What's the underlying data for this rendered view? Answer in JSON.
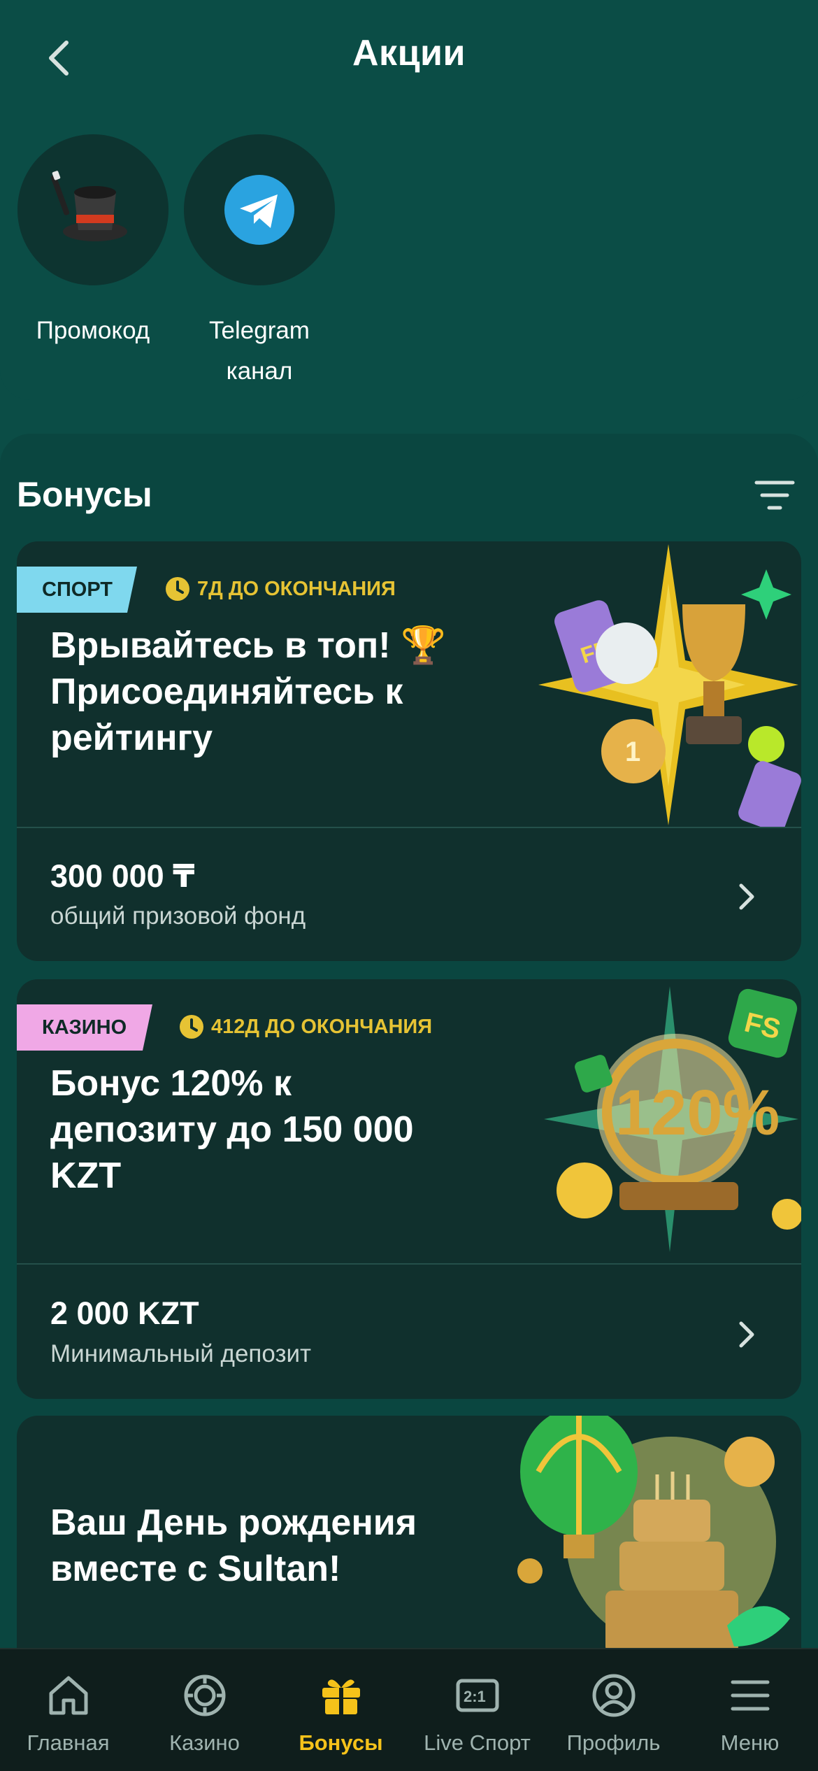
{
  "header": {
    "title": "Акции",
    "shortcuts": [
      {
        "label_line1": "Промокод",
        "label_line2": "",
        "icon": "magic-hat-icon"
      },
      {
        "label_line1": "Telegram",
        "label_line2": "канал",
        "icon": "telegram-icon"
      }
    ]
  },
  "bonuses": {
    "title": "Бонусы",
    "cards": [
      {
        "tag": "СПОРТ",
        "tag_color": "#7fd8ee",
        "deadline": "7Д ДО ОКОНЧАНИЯ",
        "title_line1": "Врывайтесь в топ! 🏆",
        "title_line2": "Присоединяйтесь к",
        "title_line3": "рейтингу",
        "value": "300 000 ₸",
        "value_caption": "общий призовой фонд"
      },
      {
        "tag": "КАЗИНО",
        "tag_color": "#f0a8e6",
        "deadline": "412Д ДО ОКОНЧАНИЯ",
        "title_line1": "Бонус 120% к",
        "title_line2": "депозиту до 150 000",
        "title_line3": "KZT",
        "value": "2 000 KZT",
        "value_caption": "Минимальный депозит",
        "art_text": "120%",
        "art_badge": "FS"
      },
      {
        "title_line1": "Ваш День рождения",
        "title_line2": "вместе с Sultan!"
      }
    ]
  },
  "nav": {
    "items": [
      {
        "label": "Главная",
        "icon": "home-icon"
      },
      {
        "label": "Казино",
        "icon": "casino-chip-icon"
      },
      {
        "label": "Бонусы",
        "icon": "gift-icon",
        "active": true
      },
      {
        "label": "Live Спорт",
        "icon": "live-score-icon",
        "badge": "2:1"
      },
      {
        "label": "Профиль",
        "icon": "profile-icon"
      },
      {
        "label": "Меню",
        "icon": "menu-icon"
      }
    ]
  },
  "colors": {
    "background": "#0b4d46",
    "card": "#10302d",
    "accent_yellow": "#f5c21a",
    "deadline_yellow": "#e6c334"
  }
}
